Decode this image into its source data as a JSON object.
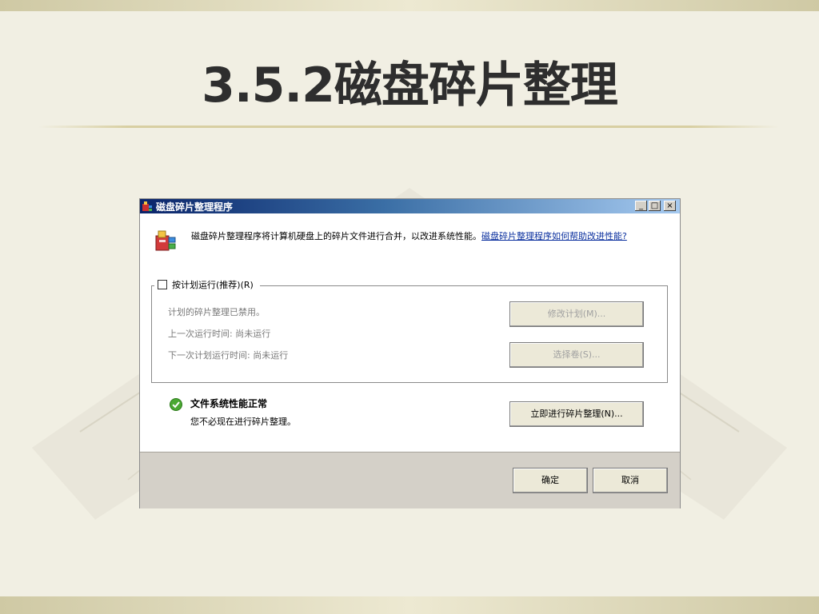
{
  "slide": {
    "title": "3.5.2磁盘碎片整理"
  },
  "dialog": {
    "title": "磁盘碎片整理程序",
    "window_buttons": {
      "minimize": "_",
      "maximize": "□",
      "close": "×"
    },
    "intro_text": "磁盘碎片整理程序将计算机硬盘上的碎片文件进行合并，以改进系统性能。",
    "help_link": "磁盘碎片整理程序如何帮助改进性能?",
    "schedule": {
      "checkbox_label": "按计划运行(推荐)(R)",
      "checked": false,
      "status": "计划的碎片整理已禁用。",
      "last_run": "上一次运行时间: 尚未运行",
      "next_run": "下一次计划运行时间: 尚未运行",
      "modify_button": "修改计划(M)...",
      "select_volumes_button": "选择卷(S)..."
    },
    "status": {
      "title": "文件系统性能正常",
      "subtitle": "您不必现在进行碎片整理。",
      "defrag_now_button": "立即进行碎片整理(N)..."
    },
    "footer": {
      "ok_button": "确定",
      "cancel_button": "取消"
    }
  },
  "colors": {
    "titlebar_start": "#0a246a",
    "titlebar_end": "#a6caf0",
    "link": "#0a2f9e",
    "status_ok": "#4aa832"
  },
  "icons": {
    "title_icon": "defrag-app-icon",
    "intro_icon": "defrag-app-icon",
    "status_icon": "check-circle-icon"
  }
}
